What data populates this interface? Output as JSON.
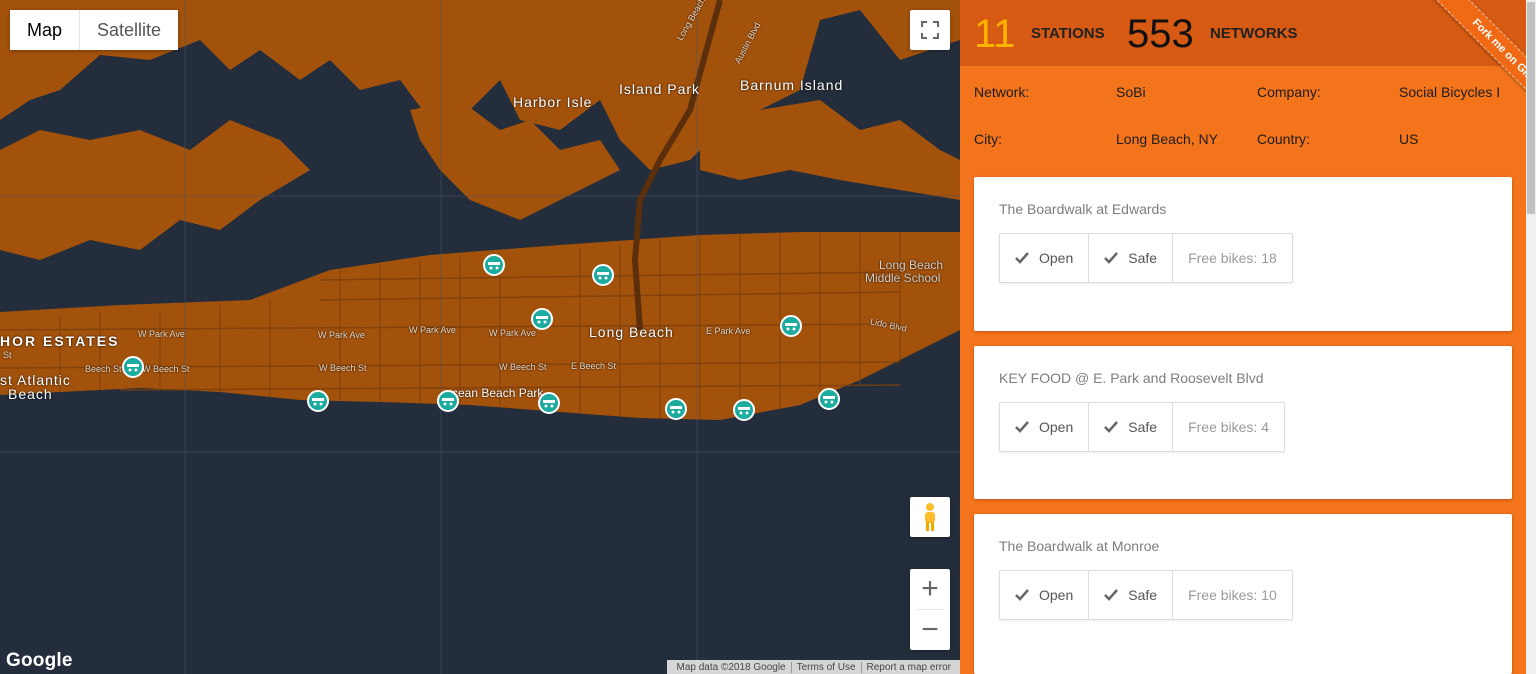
{
  "map": {
    "type_buttons": [
      "Map",
      "Satellite"
    ],
    "active_type": "Map",
    "attribution": [
      "Map data ©2018 Google",
      "Terms of Use",
      "Report a map error"
    ],
    "google_logo": "Google",
    "labels": {
      "harbor_isle": "Harbor Isle",
      "island_park": "Island Park",
      "barnum_island": "Barnum Island",
      "long_beach": "Long Beach",
      "harbor_estates": "HOR ESTATES",
      "east_atlantic_1": "st Atlantic",
      "east_atlantic_2": "Beach",
      "school_1": "Long Beach",
      "school_2": "Middle School",
      "ocean_beach_park": "cean Beach Park",
      "streets": {
        "w_park_ave_1": "W Park Ave",
        "w_park_ave_2": "W Park Ave",
        "w_park_ave_3": "W Park Ave",
        "w_park_ave_4": "W Park Ave",
        "e_park_ave": "E Park Ave",
        "lido_blvd": "Lido Blvd",
        "beech_st": "Beech St",
        "w_beech_st_1": "W Beech St",
        "w_beech_st_2": "W Beech St",
        "w_beech_st_3": "W Beech St",
        "e_beech_st": "E Beech St",
        "long_beach_rd": "Long Beach",
        "austin_blvd": "Austin Blvd",
        "st": "St"
      }
    },
    "icons": {
      "station_marker": "bike-station-icon",
      "fullscreen": "fullscreen-icon",
      "pegman": "street-view-pegman-icon",
      "zoom_in": "+",
      "zoom_out": "−"
    }
  },
  "panel": {
    "stations_count": "11",
    "stations_label": "STATIONS",
    "networks_count": "553",
    "networks_label": "NETWORKS",
    "info": {
      "network_label": "Network:",
      "network_value": "SoBi",
      "company_label": "Company:",
      "company_value": "Social Bicycles I",
      "city_label": "City:",
      "city_value": "Long Beach, NY",
      "country_label": "Country:",
      "country_value": "US"
    },
    "ribbon": "Fork me on GitHub",
    "stations": [
      {
        "name": "The Boardwalk at Edwards",
        "open": "Open",
        "safe": "Safe",
        "free": "Free bikes: 18"
      },
      {
        "name": "KEY FOOD @ E. Park and Roosevelt Blvd",
        "open": "Open",
        "safe": "Safe",
        "free": "Free bikes: 4"
      },
      {
        "name": "The Boardwalk at Monroe",
        "open": "Open",
        "safe": "Safe",
        "free": "Free bikes: 10"
      }
    ]
  },
  "colors": {
    "land": "#a3520c",
    "water": "#232d3b",
    "panel_orange": "#f4741c",
    "panel_header": "#d65a13",
    "stations_count": "#ffb300",
    "marker": "#1cab9f"
  }
}
